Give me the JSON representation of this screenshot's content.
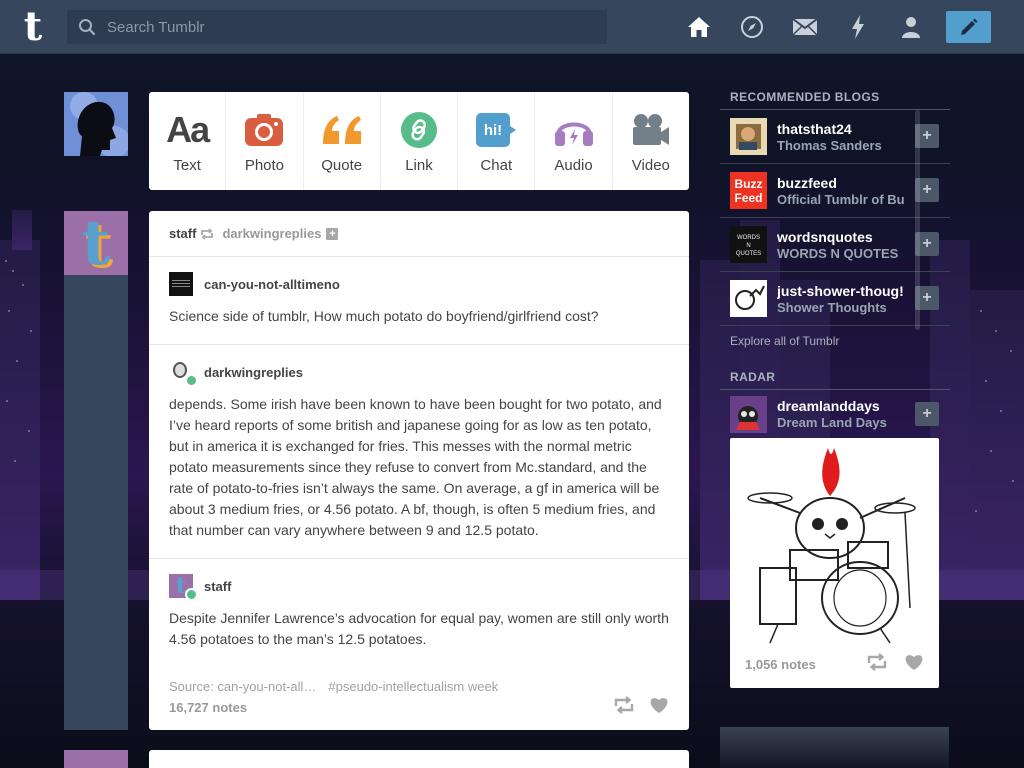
{
  "header": {
    "search_placeholder": "Search Tumblr",
    "nav": [
      "home-icon",
      "explore-compass-icon",
      "inbox-mail-icon",
      "activity-lightning-icon",
      "account-person-icon"
    ],
    "compose_icon": "pencil-icon",
    "logo_letter": "t"
  },
  "post_types": [
    {
      "label": "Text",
      "icon": "text-aa-icon",
      "color": "#444444"
    },
    {
      "label": "Photo",
      "icon": "camera-icon",
      "color": "#d95e40"
    },
    {
      "label": "Quote",
      "icon": "quote-icon",
      "color": "#f2992e"
    },
    {
      "label": "Link",
      "icon": "link-icon",
      "color": "#56bc8a"
    },
    {
      "label": "Chat",
      "icon": "chat-bubble-icon",
      "color": "#529ecc"
    },
    {
      "label": "Audio",
      "icon": "headphones-icon",
      "color": "#a77dc2"
    },
    {
      "label": "Video",
      "icon": "video-camera-icon",
      "color": "#748089"
    }
  ],
  "post": {
    "author": "staff",
    "reblogged_from": "darkwingreplies",
    "plus": "+",
    "reblogs": [
      {
        "blog": "can-you-not-alltimeno",
        "text": "Science side of tumblr, How much potato do boyfriend/girlfriend cost?"
      },
      {
        "blog": "darkwingreplies",
        "text": "depends. Some irish have been known to have been bought for two potato, and I’ve heard reports of some british and japanese going for as low as ten potato, but in america it is exchanged for fries. This messes with the normal metric potato measurements since they refuse to convert from Mc.standard, and the rate of potato-to-fries isn’t always the same. On average, a gf in america will be about 3 medium fries, or 4.56 potato. A bf, though, is often 5 medium fries, and that number can vary anywhere between 9 and 12.5 potato."
      },
      {
        "blog": "staff",
        "text": "Despite Jennifer Lawrence’s advocation for equal pay, women are still only worth 4.56 potatoes to the man’s 12.5 potatoes."
      }
    ],
    "source": "Source: can-you-not-all…",
    "tag": "#pseudo-intellectualism week",
    "notes": "16,727 notes"
  },
  "sidebar": {
    "recommended_heading": "RECOMMENDED BLOGS",
    "blogs": [
      {
        "name": "thatsthat24",
        "title": "Thomas Sanders",
        "thumb_color": "#e9d9b2"
      },
      {
        "name": "buzzfeed",
        "title": "Official Tumblr of Bu",
        "thumb_color": "#ee3322",
        "thumb_text": "Buzz Feed"
      },
      {
        "name": "wordsnquotes",
        "title": "WORDS N QUOTES",
        "thumb_color": "#111111",
        "thumb_text": "WORDS N QUOTES"
      },
      {
        "name": "just-shower-thoug!",
        "title": "Shower Thoughts",
        "thumb_color": "#ffffff"
      }
    ],
    "follow_label": "+",
    "explore": "Explore all of Tumblr",
    "radar_heading": "RADAR",
    "radar_blog": {
      "name": "dreamlanddays",
      "title": "Dream Land Days"
    },
    "radar_notes": "1,056 notes"
  }
}
